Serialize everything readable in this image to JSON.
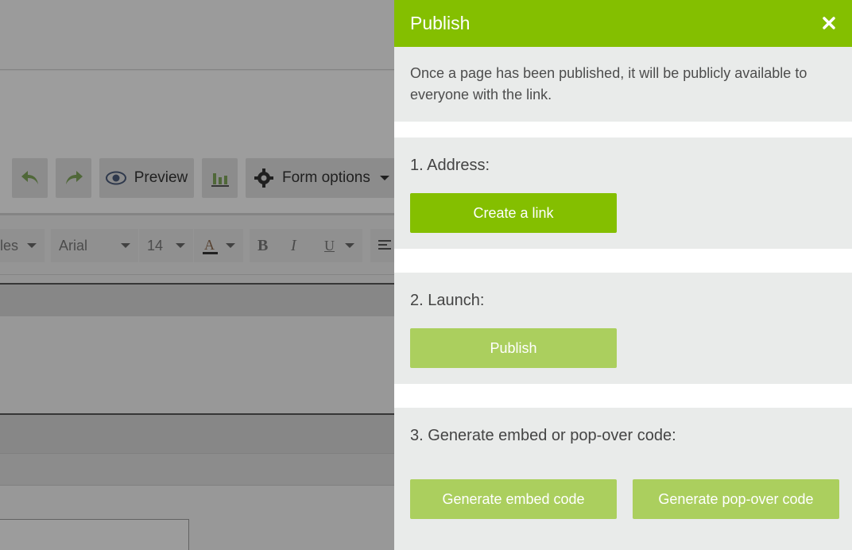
{
  "editor": {
    "toolbar": {
      "preview_label": "Preview",
      "form_options_label": "Form options"
    },
    "format_bar": {
      "styles_label": "les",
      "font_label": "Arial",
      "size_label": "14",
      "bold_label": "B",
      "italic_label": "I",
      "underline_label": "U"
    }
  },
  "panel": {
    "title": "Publish",
    "intro": "Once a page has been published, it will be publicly available to everyone with the link.",
    "sections": [
      {
        "title": "1. Address:",
        "button": "Create a link"
      },
      {
        "title": "2. Launch:",
        "button": "Publish"
      },
      {
        "title": "3. Generate embed or pop-over code:",
        "buttons": [
          "Generate embed code",
          "Generate pop-over code"
        ]
      }
    ]
  },
  "colors": {
    "accent": "#84bf00",
    "accent_disabled": "#abcf5e",
    "section_bg": "#e9ebea"
  },
  "icons": [
    "undo-icon",
    "redo-icon",
    "eye-icon",
    "bar-chart-icon",
    "gear-icon",
    "font-color-icon",
    "align-left-icon",
    "close-icon"
  ]
}
